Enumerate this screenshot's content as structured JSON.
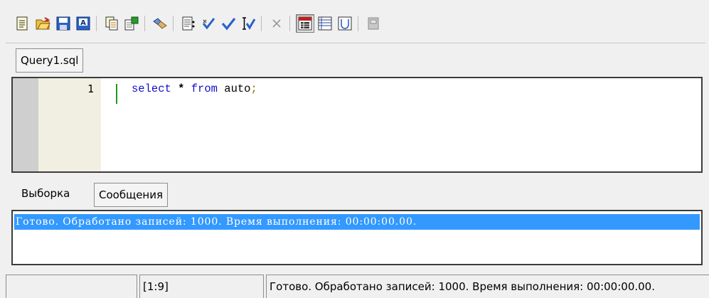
{
  "toolbar": {
    "buttons": [
      {
        "name": "new-file-icon"
      },
      {
        "name": "open-file-icon"
      },
      {
        "name": "save-icon"
      },
      {
        "name": "format-icon"
      },
      {
        "name": "copy-icon"
      },
      {
        "name": "export-icon"
      },
      {
        "name": "connect-icon"
      },
      {
        "name": "run-script-icon"
      },
      {
        "name": "commit-icon"
      },
      {
        "name": "check-icon"
      },
      {
        "name": "check-cursor-icon"
      },
      {
        "name": "cancel-icon"
      },
      {
        "name": "results-grid-icon"
      },
      {
        "name": "table-view-icon"
      },
      {
        "name": "union-icon"
      },
      {
        "name": "print-icon"
      }
    ]
  },
  "editor": {
    "tab_label": "Query1.sql",
    "line_number": "1",
    "code": {
      "kw_select": "select",
      "star": "*",
      "kw_from": "from",
      "table": "auto",
      "semicolon": ";"
    }
  },
  "results": {
    "tabs": [
      {
        "label": "Выборка"
      },
      {
        "label": "Сообщения"
      }
    ],
    "message": "Готово. Обработано записей: 1000. Время выполнения: 00:00:00.00."
  },
  "statusbar": {
    "cell1": "",
    "cursor_position": "[1:9]",
    "message": "Готово. Обработано записей: 1000. Время выполнения: 00:00:00.00."
  },
  "colors": {
    "selection": "#3399ff",
    "keyword": "#1010c8",
    "gutter": "#f1efe1",
    "line_marker": "#1a9a1a"
  }
}
